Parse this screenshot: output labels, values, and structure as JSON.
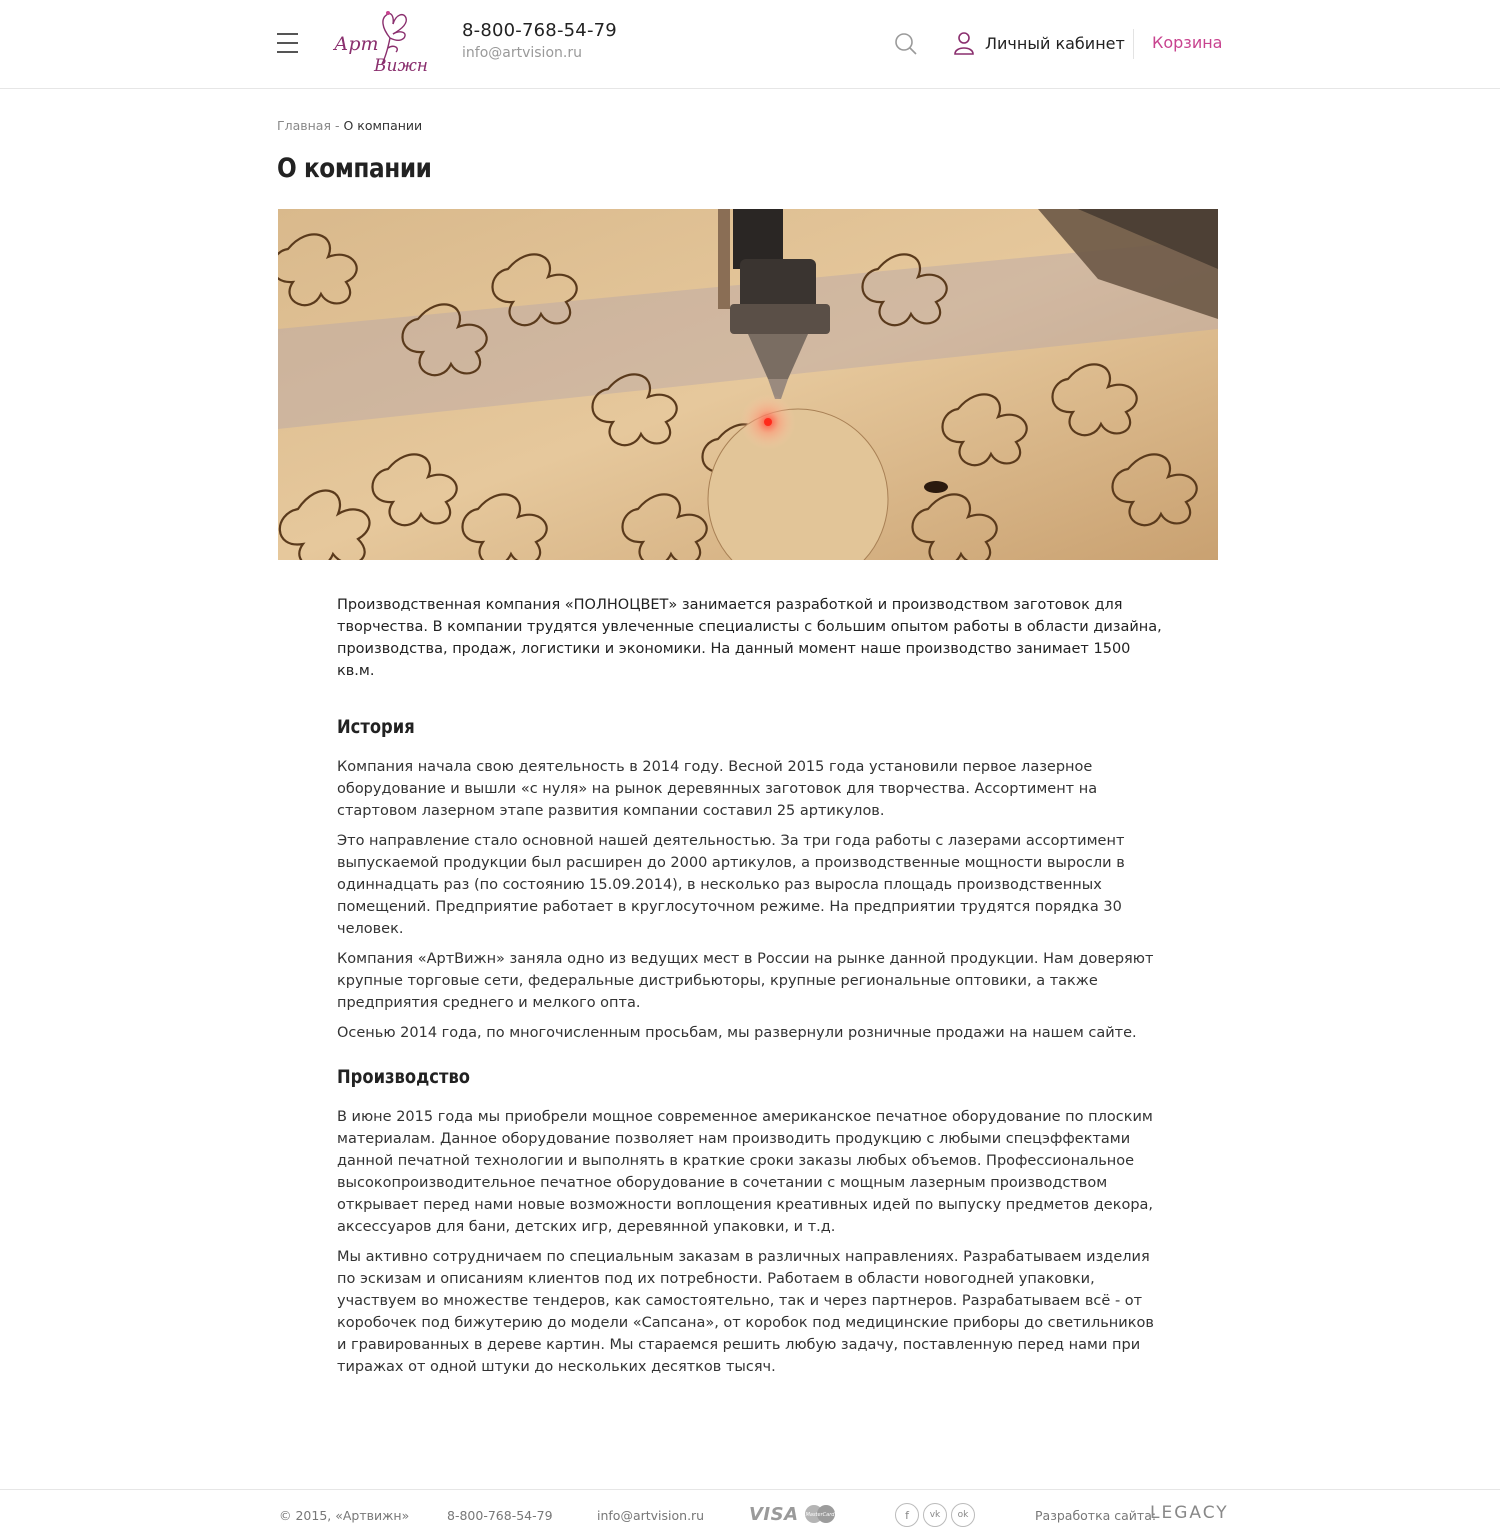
{
  "header": {
    "phone": "8-800-768-54-79",
    "email": "info@artvision.ru",
    "cabinet_label": "Личный кабинет",
    "cart_label": "Корзина",
    "logo_text_1": "Арт",
    "logo_text_2": "Вижн",
    "icons": [
      "menu-icon",
      "search-icon",
      "user-icon"
    ],
    "accent_color": "#c8438f",
    "logo_color": "#8a2f6e"
  },
  "breadcrumb": {
    "home": "Главная",
    "separator": " - ",
    "current": "О компании"
  },
  "page": {
    "title": "О компании",
    "intro": "Производственная компания «ПОЛНОЦВЕТ» занимается разработкой и производством заготовок для творчества. В компании трудятся увлеченные специалисты с большим опытом работы в области дизайна, производства, продаж, логистики и экономики. На данный момент наше производство занимает 1500 кв.м.",
    "history": {
      "title": "История",
      "paragraphs": [
        "Компания начала свою деятельность в 2014 году. Весной 2015 года установили первое лазерное оборудование и вышли «с нуля» на рынок деревянных заготовок для творчества. Ассортимент на стартовом лазерном этапе развития компании составил 25 артикулов.",
        "Это направление стало основной нашей деятельностью. За три года работы с лазерами ассортимент выпускаемой продукции был расширен до 2000 артикулов, а производственные мощности выросли в одиннадцать раз (по состоянию 15.09.2014), в несколько раз выросла площадь производственных помещений. Предприятие работает в круглосуточном режиме. На предприятии трудятся порядка 30 человек.",
        "Компания «АртВижн» заняла одно из ведущих мест в России на рынке данной продукции. Нам доверяют крупные торговые сети, федеральные дистрибьюторы, крупные региональные оптовики, а также предприятия среднего и мелкого опта.",
        "Осенью 2014 года, по многочисленным просьбам, мы развернули розничные продажи на нашем сайте."
      ]
    },
    "production": {
      "title": "Производство",
      "paragraphs": [
        "В июне 2015 года мы приобрели мощное современное американское печатное оборудование по плоским матери­алам. Данное оборудование позволяет нам производить продукцию с любыми спецэффектами данной печатной технологии и выполнять в краткие сроки заказы любых объемов. Профессиональное высокопроизводительное печатное оборудование в сочетании с мощным лазерным производством открывает перед нами новые возможности воплощения креативных идей по выпуску предметов декора, аксессуаров для бани, детских игр, деревянной упаковки, и т.д.",
        "Мы активно сотрудничаем по специальным заказам в различных направлениях. Разрабатываем изделия по эскизам и описаниям клиентов под их потребности. Работаем в области новогодней упаковки, участвуем во множестве тендеров, как самостоятельно, так и через партнеров. Разрабатываем всё - от коробочек под бижутерию до модели «Сапсана», от коробок под медицинские приборы до светильников и гравированных в дереве картин. Мы стараемся решить любую задачу, поставленную перед нами при тиражах от одной штуки до нескольких десятков тысяч."
      ]
    }
  },
  "footer": {
    "copyright": "© 2015, «Артвижн»",
    "phone": "8-800-768-54-79",
    "email": "info@artvision.ru",
    "visa": "VISA",
    "mastercard": "MasterCard",
    "social": [
      "f",
      "vk",
      "ok"
    ],
    "dev_label": "Разработка сайта:",
    "dev_name": "LEGACY"
  }
}
